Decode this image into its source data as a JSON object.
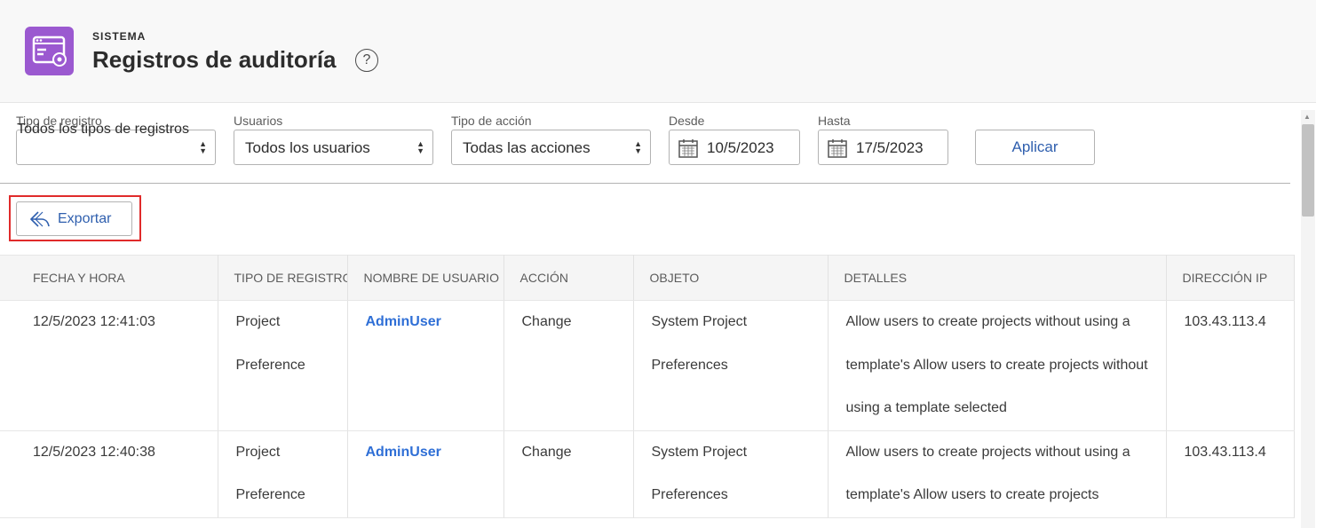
{
  "header": {
    "section": "SISTEMA",
    "title": "Registros de auditoría",
    "help_icon": "?",
    "app_icon": "audit-log-settings-icon",
    "accent_color": "#9b59d0"
  },
  "filters": {
    "log_type": {
      "label": "Tipo de registro",
      "value": "Todos los tipos de registros"
    },
    "users": {
      "label": "Usuarios",
      "value": "Todos los usuarios"
    },
    "action_type": {
      "label": "Tipo de acción",
      "value": "Todas las acciones"
    },
    "from": {
      "label": "Desde",
      "value": "10/5/2023"
    },
    "to": {
      "label": "Hasta",
      "value": "17/5/2023"
    },
    "apply_label": "Aplicar"
  },
  "toolbar": {
    "export_label": "Exportar"
  },
  "table": {
    "columns": [
      "FECHA Y HORA",
      "TIPO DE REGISTRO",
      "NOMBRE DE USUARIO",
      "ACCIÓN",
      "OBJETO",
      "DETALLES",
      "DIRECCIÓN IP"
    ],
    "rows": [
      {
        "datetime": "12/5/2023 12:41:03",
        "type": "Project Preference",
        "user": "AdminUser",
        "action": "Change",
        "object": "System Project Preferences",
        "details": "Allow users to create projects without using a template's Allow users to create projects without using a template selected",
        "ip": "103.43.113.4"
      },
      {
        "datetime": "12/5/2023 12:40:38",
        "type": "Project Preference",
        "user": "AdminUser",
        "action": "Change",
        "object": "System Project Preferences",
        "details": "Allow users to create projects without using a template's Allow users to create projects",
        "ip": "103.43.113.4"
      }
    ]
  }
}
